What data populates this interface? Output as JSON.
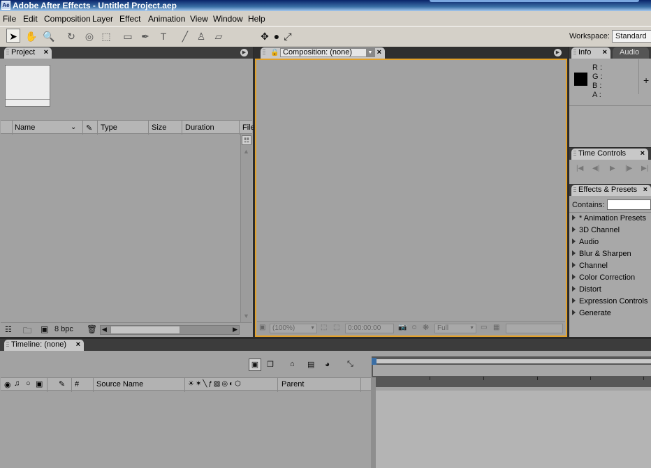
{
  "window": {
    "title": "Adobe After Effects - Untitled Project.aep"
  },
  "menu": [
    "File",
    "Edit",
    "Composition",
    "Layer",
    "Effect",
    "Animation",
    "View",
    "Window",
    "Help"
  ],
  "toolbar": {
    "workspace_label": "Workspace:",
    "workspace_value": "Standard"
  },
  "project": {
    "tab_label": "Project",
    "columns": [
      "Name",
      "Type",
      "Size",
      "Duration",
      "File"
    ],
    "bit_depth": "8 bpc"
  },
  "composition": {
    "tab_label": "Composition: (none)",
    "zoom": "(100%)",
    "timecode": "0:00:00:00",
    "resolution": "Full"
  },
  "info": {
    "tab_label": "Info",
    "tab2_label": "Audio",
    "channels": [
      "R :",
      "G :",
      "B :",
      "A :"
    ]
  },
  "time_controls": {
    "tab_label": "Time Controls"
  },
  "effects": {
    "tab_label": "Effects & Presets",
    "contains_label": "Contains:",
    "items": [
      "* Animation Presets",
      "3D Channel",
      "Audio",
      "Blur & Sharpen",
      "Channel",
      "Color Correction",
      "Distort",
      "Expression Controls",
      "Generate"
    ]
  },
  "timeline": {
    "tab_label": "Timeline: (none)",
    "columns": {
      "number": "#",
      "source_name": "Source Name",
      "parent": "Parent"
    }
  }
}
